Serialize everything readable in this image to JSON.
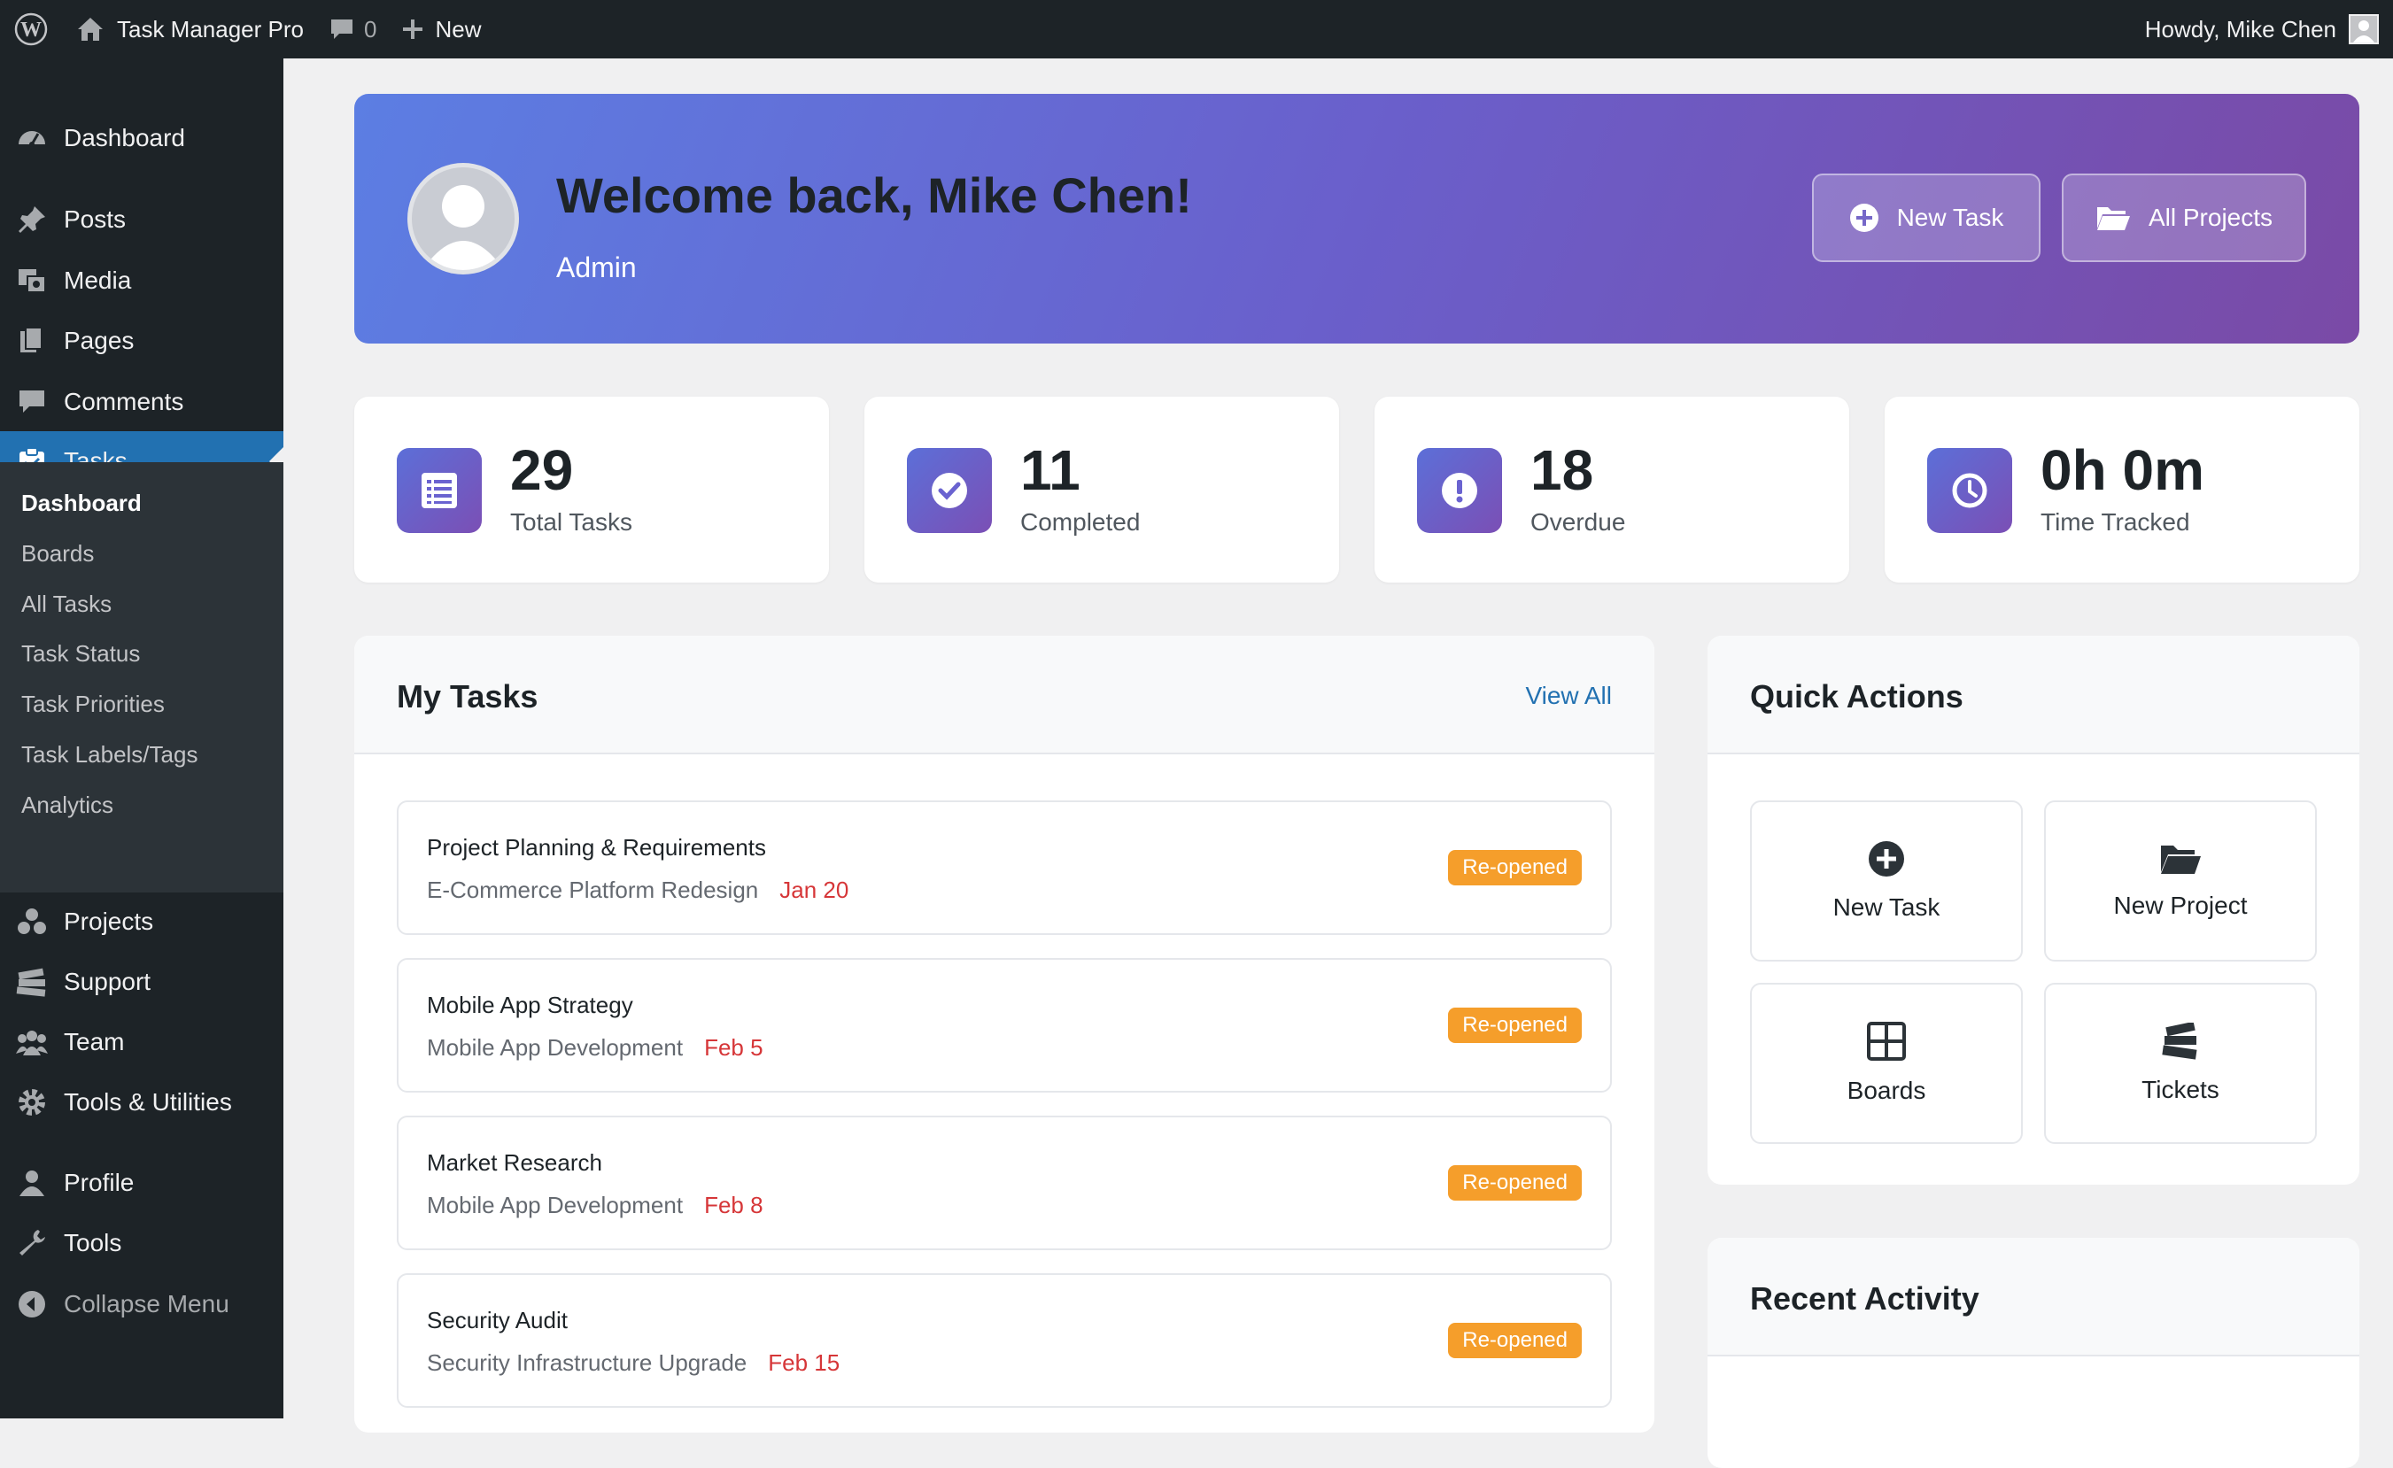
{
  "adminbar": {
    "site_name": "Task Manager Pro",
    "comments_count": "0",
    "new_label": "New",
    "howdy": "Howdy, Mike Chen"
  },
  "sidebar": {
    "items": [
      {
        "label": "Dashboard",
        "icon": "dashboard-icon"
      },
      {
        "label": "Posts",
        "icon": "pin-icon"
      },
      {
        "label": "Media",
        "icon": "media-icon"
      },
      {
        "label": "Pages",
        "icon": "pages-icon"
      },
      {
        "label": "Comments",
        "icon": "comment-icon"
      },
      {
        "label": "Tasks",
        "icon": "tasks-icon"
      }
    ],
    "submenu": [
      "Dashboard",
      "Boards",
      "All Tasks",
      "Task Status",
      "Task Priorities",
      "Task Labels/Tags",
      "Analytics"
    ],
    "items2": [
      {
        "label": "Projects",
        "icon": "projects-icon"
      },
      {
        "label": "Support",
        "icon": "support-icon"
      },
      {
        "label": "Team",
        "icon": "team-icon"
      },
      {
        "label": "Tools & Utilities",
        "icon": "gear-icon"
      },
      {
        "label": "Profile",
        "icon": "user-icon"
      },
      {
        "label": "Tools",
        "icon": "wrench-icon"
      },
      {
        "label": "Collapse Menu",
        "icon": "collapse-icon"
      }
    ]
  },
  "welcome": {
    "title": "Welcome back, Mike Chen!",
    "role": "Admin",
    "new_task_label": "New Task",
    "all_projects_label": "All Projects"
  },
  "stats": [
    {
      "value": "29",
      "label": "Total Tasks",
      "icon": "list-icon"
    },
    {
      "value": "11",
      "label": "Completed",
      "icon": "check-icon"
    },
    {
      "value": "18",
      "label": "Overdue",
      "icon": "alert-icon"
    },
    {
      "value": "0h 0m",
      "label": "Time Tracked",
      "icon": "clock-icon"
    }
  ],
  "my_tasks": {
    "title": "My Tasks",
    "view_all": "View All",
    "tasks": [
      {
        "title": "Project Planning & Requirements",
        "project": "E-Commerce Platform Redesign",
        "due": "Jan 20",
        "status": "Re-opened"
      },
      {
        "title": "Mobile App Strategy",
        "project": "Mobile App Development",
        "due": "Feb 5",
        "status": "Re-opened"
      },
      {
        "title": "Market Research",
        "project": "Mobile App Development",
        "due": "Feb 8",
        "status": "Re-opened"
      },
      {
        "title": "Security Audit",
        "project": "Security Infrastructure Upgrade",
        "due": "Feb 15",
        "status": "Re-opened"
      }
    ]
  },
  "quick_actions": {
    "title": "Quick Actions",
    "items": [
      {
        "label": "New Task",
        "icon": "plus-circle-icon"
      },
      {
        "label": "New Project",
        "icon": "folder-open-icon"
      },
      {
        "label": "Boards",
        "icon": "grid-icon"
      },
      {
        "label": "Tickets",
        "icon": "tickets-icon"
      }
    ]
  },
  "recent_activity": {
    "title": "Recent Activity"
  },
  "colors": {
    "admin_bar": "#1d2327",
    "accent_blue": "#2271b1",
    "banner_start": "#5c7ee3",
    "banner_end": "#7a4aa6",
    "badge_orange": "#f59e2b",
    "due_red": "#d63638"
  }
}
